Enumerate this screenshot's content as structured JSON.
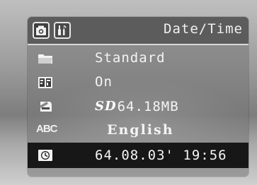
{
  "header": {
    "title": "Date/Time",
    "tabs": [
      {
        "icon": "camera-icon"
      },
      {
        "icon": "setup-wrench-icon"
      }
    ]
  },
  "menu": {
    "items": [
      {
        "icon": "folder-icon",
        "value": "Standard"
      },
      {
        "icon": "quick-view-icon",
        "value": "On"
      },
      {
        "icon": "memory-card-icon",
        "badge": "SD",
        "value": "64.18MB"
      },
      {
        "icon": "language-icon",
        "label": "ABC",
        "value": "English"
      },
      {
        "icon": "clock-icon",
        "value": "64.08.03' 19:56",
        "selected": true
      }
    ]
  },
  "colors": {
    "panel": "#767676",
    "header": "#5c5c5c",
    "selected_row": "#171717",
    "text": "#f4f4f4"
  }
}
